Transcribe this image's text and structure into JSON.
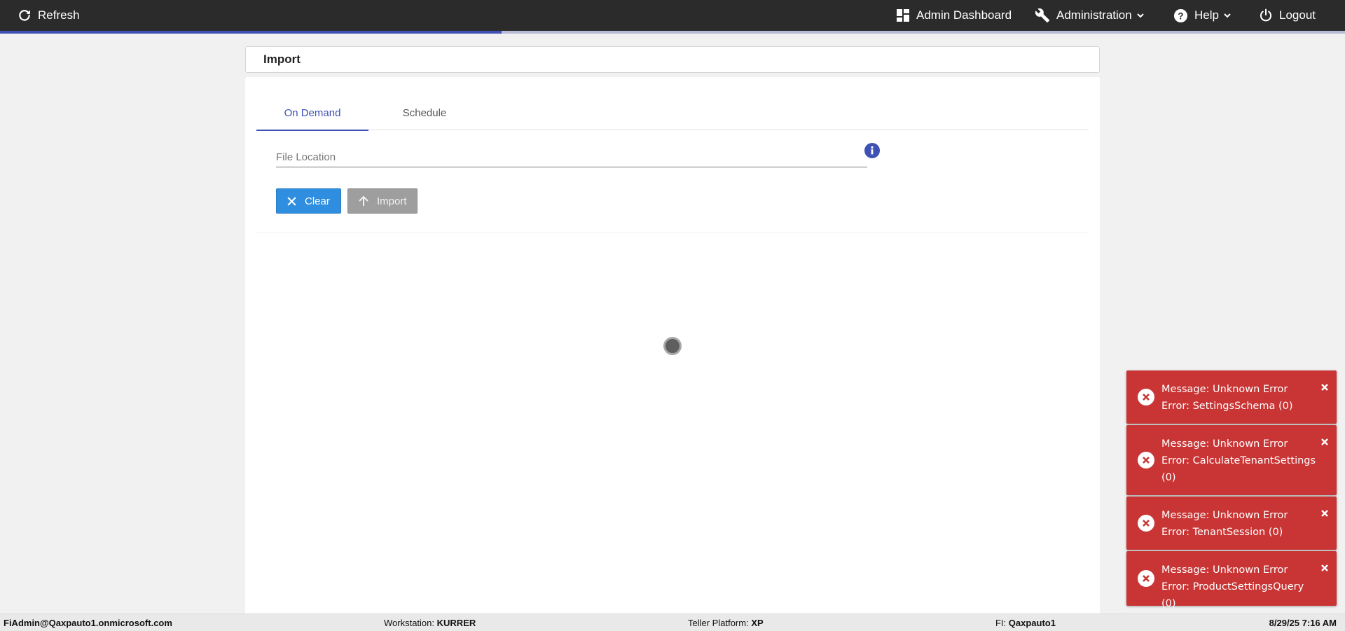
{
  "topbar": {
    "refresh_label": "Refresh",
    "admin_dashboard_label": "Admin Dashboard",
    "administration_label": "Administration",
    "help_label": "Help",
    "logout_label": "Logout",
    "background_color": "#2b2b2b",
    "progress_fraction": 0.373
  },
  "page": {
    "title": "Import"
  },
  "tabs": [
    {
      "label": "On Demand",
      "active": true
    },
    {
      "label": "Schedule",
      "active": false
    }
  ],
  "form": {
    "file_location_placeholder": "File Location",
    "file_location_value": "",
    "info_icon": "info-icon"
  },
  "buttons": {
    "clear_label": "Clear",
    "import_label": "Import"
  },
  "footer": {
    "user": "FiAdmin@Qaxpauto1.onmicrosoft.com",
    "workstation_label": "Workstation:",
    "workstation_value": "KURRER",
    "teller_platform_label": "Teller Platform:",
    "teller_platform_value": "XP",
    "fi_label": "FI:",
    "fi_value": "Qaxpauto1",
    "datetime": "8/29/25 7:16 AM"
  },
  "toasts": [
    {
      "message": "Message: Unknown Error",
      "error": "Error: SettingsSchema (0)"
    },
    {
      "message": "Message: Unknown Error",
      "error": "Error: CalculateTenantSettings (0)"
    },
    {
      "message": "Message: Unknown Error",
      "error": "Error: TenantSession (0)"
    },
    {
      "message": "Message: Unknown Error",
      "error": "Error: ProductSettingsQuery (0)"
    }
  ],
  "colors": {
    "accent": "#3f51b5",
    "clear_button": "#2f8ee0",
    "import_button_disabled": "#9e9e9e",
    "toast_error": "#c93434"
  }
}
